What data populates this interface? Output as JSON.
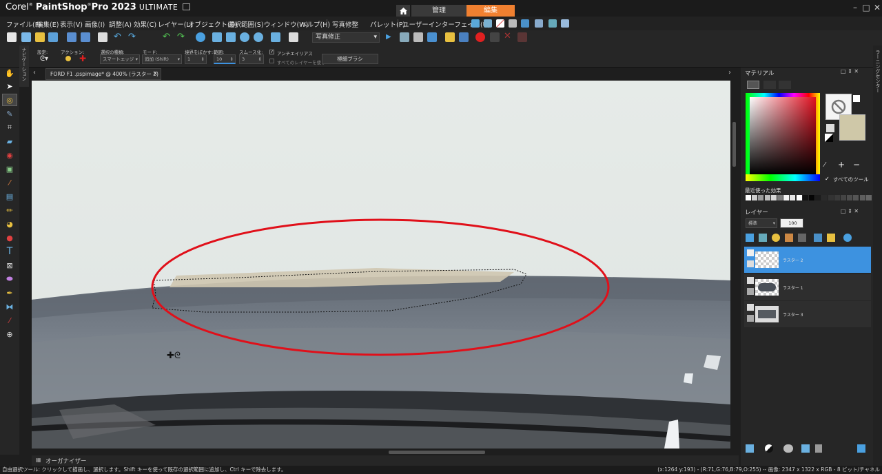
{
  "titlebar": {
    "brand": "Corel",
    "product": "PaintShop",
    "product2": "Pro",
    "version": "2023",
    "edition": "ULTIMATE",
    "tab_manage": "管理",
    "tab_edit": "編集",
    "min": "–",
    "max": "□",
    "close": "✕"
  },
  "menu": {
    "items": [
      "ファイル(F)",
      "編集(E)",
      "表示(V)",
      "画像(I)",
      "調整(A)",
      "効果(C)",
      "レイヤー(L)",
      "オブジェクト(O)",
      "選択範囲(S)",
      "ウィンドウ(W)",
      "ヘルプ(H)",
      "写真修整",
      "パレット(P)",
      "ユーザーインターフェイス(U)"
    ]
  },
  "toolbar": {
    "preset": "写真修正"
  },
  "options": {
    "preset_label": "設定:",
    "action_label": "アクション:",
    "selection_type_label": "選択の種類:",
    "selection_type_value": "スマートエッジ",
    "mode_label": "モード:",
    "mode_value": "追加 (Shift)",
    "feather_label": "境界をぼかす:",
    "feather_value": "1",
    "range_label": "範囲:",
    "range_value": "10",
    "smoothing_label": "スムース化:",
    "smoothing_value": "3",
    "antialias_label": "アンチエイリアス",
    "use_all_layers_label": "すべてのレイヤーを使う",
    "brush_button": "極細ブラシ"
  },
  "nav_strip_label": "ナビゲーション",
  "document": {
    "tab_title": "FORD F1 .pspimage* @ 400% (ラスター 2)",
    "close": "×"
  },
  "organizer_label": "オーガナイザー",
  "status": {
    "left": "自由選択ツール: クリックして描画し、選択します。Shift キーを使って既存の選択範囲に追加し、Ctrl キーで除去します。",
    "right": "(x:1264 y:193) - (R:71,G:76,B:79,O:255) -- 画像: 2347 x 1322 x RGB - 8 ビット/チャネル"
  },
  "materials": {
    "title": "マテリアル",
    "all_tools_label": "すべてのツール",
    "recent_label": "最近使った効果",
    "swatches": [
      "#ffffff",
      "#cfcfcf",
      "#9a9a9a",
      "#bdbdbd",
      "#d8d8d8",
      "#7a7a7a",
      "#f2f2f2",
      "#e6e6e6",
      "#ffffff",
      "#111111",
      "#050505",
      "#1c1c1c",
      "#2a2a2a",
      "#333333",
      "#3a3a3a",
      "#444444",
      "#4d4d4d",
      "#555555",
      "#5e5e5e",
      "#666666"
    ]
  },
  "layers": {
    "title": "レイヤー",
    "blend": "標準",
    "opacity": "100",
    "items": [
      {
        "name": "ラスター 2",
        "selected": true
      },
      {
        "name": "ラスター 1",
        "selected": false
      },
      {
        "name": "ラスター 3",
        "selected": false
      }
    ]
  },
  "learning_center_label": "ラーニングセンター",
  "colors": {
    "accent_orange": "#f08030",
    "selection_blue": "#3d92e0",
    "annotation_red": "#e0101a"
  }
}
